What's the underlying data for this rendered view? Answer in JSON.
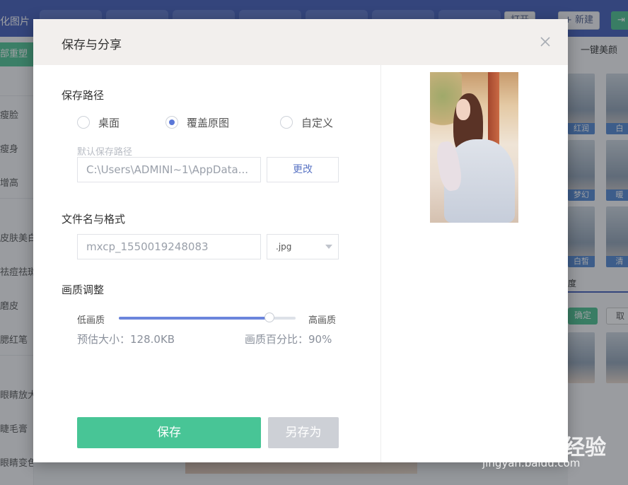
{
  "app": {
    "left_title": "化图片",
    "sidebar": {
      "active_item": "部重塑",
      "items": [
        "瘦脸",
        "瘦身",
        "增高",
        "皮肤美白",
        "祛痘祛斑",
        "磨皮",
        "腮红笔",
        "眼睛放大",
        "睫毛膏",
        "眼睛变色"
      ]
    },
    "header_buttons": {
      "open": "打开",
      "new": "新建"
    },
    "right_panel": {
      "title": "一键美颜",
      "thumb_captions": [
        "红润",
        "白",
        "梦幻",
        "暖",
        "白皙",
        "清"
      ],
      "section_label": "度",
      "confirm": "确定",
      "cancel": "取"
    }
  },
  "dialog": {
    "title": "保存与分享",
    "close_icon": "close-icon",
    "save_path": {
      "title": "保存路径",
      "options": [
        {
          "label": "桌面",
          "selected": false
        },
        {
          "label": "覆盖原图",
          "selected": true
        },
        {
          "label": "自定义",
          "selected": false
        }
      ],
      "default_label": "默认保存路径",
      "path_value": "C:\\Users\\ADMINI~1\\AppData...",
      "change_button": "更改"
    },
    "filename": {
      "title": "文件名与格式",
      "name_value": "mxcp_1550019248083",
      "format_value": ".jpg"
    },
    "quality": {
      "title": "画质调整",
      "low_label": "低画质",
      "high_label": "高画质",
      "level_percent": 85,
      "estimate_text": "预估大小：128.0KB",
      "percent_text": "画质百分比：90%"
    },
    "save_button": "保存",
    "save_as_button": "另存为"
  },
  "watermark": {
    "text": "Bai du 经验",
    "url": "jingyan.baidu.com"
  },
  "colors": {
    "accent_blue": "#5b78d8",
    "save_green": "#48c596",
    "topbar_blue": "#3f5ab8"
  }
}
